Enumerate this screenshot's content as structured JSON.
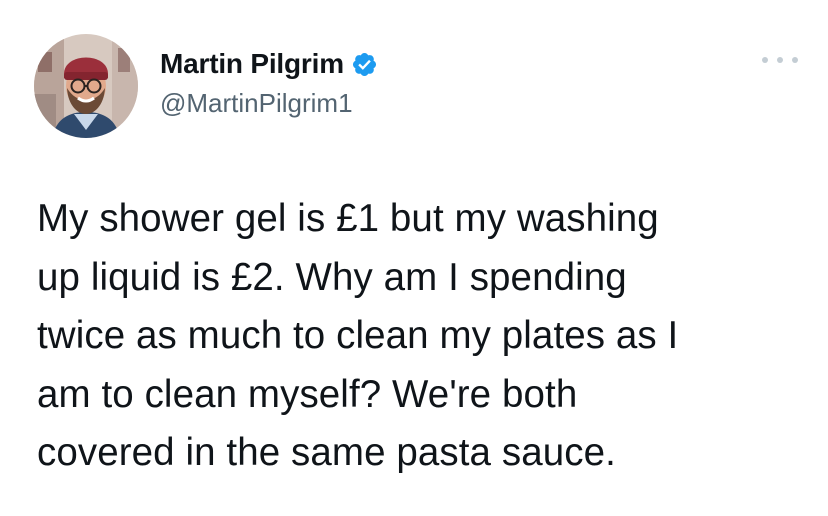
{
  "author": {
    "display_name": "Martin Pilgrim",
    "handle": "@MartinPilgrim1",
    "verified": true,
    "avatar_icon": "profile-photo",
    "verified_icon": "verified-badge-icon",
    "verified_color": "#1d9bf0"
  },
  "menu": {
    "more_icon": "more-options-icon"
  },
  "tweet": {
    "text": "My shower gel is £1 but my washing\nup liquid is £2. Why am I spending\ntwice as much to clean my plates as I\nam to clean myself? We're both\ncovered in the same pasta sauce."
  }
}
